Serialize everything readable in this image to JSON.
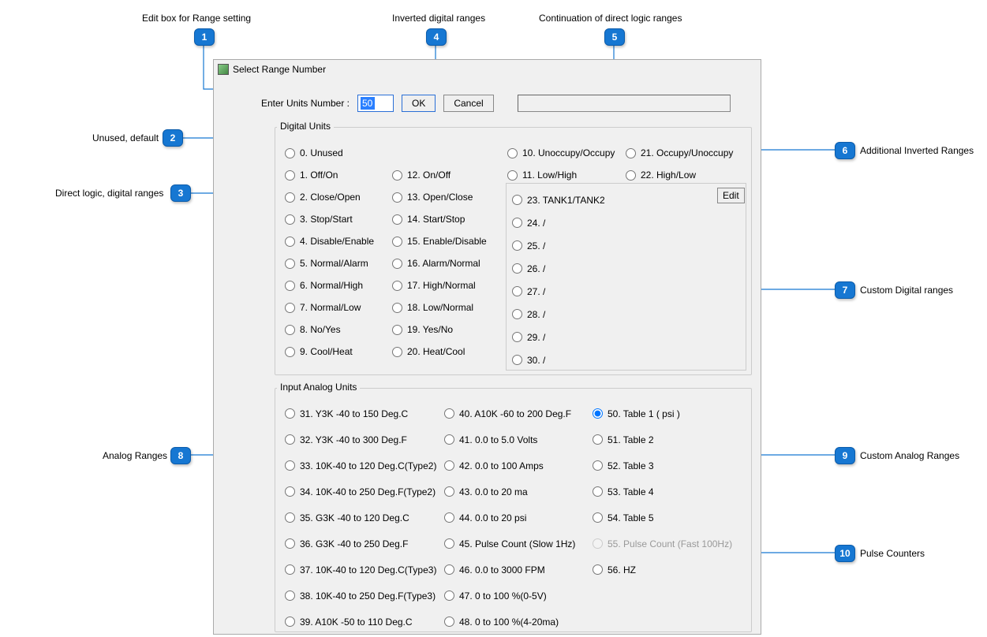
{
  "dialog": {
    "title": "Select Range Number",
    "enter_label": "Enter Units Number :",
    "enter_value": "50",
    "ok": "OK",
    "cancel": "Cancel"
  },
  "groups": {
    "digital": "Digital Units",
    "analog": "Input Analog Units"
  },
  "digital_col1": [
    "0. Unused",
    "1. Off/On",
    "2. Close/Open",
    "3. Stop/Start",
    "4. Disable/Enable",
    "5. Normal/Alarm",
    "6. Normal/High",
    "7. Normal/Low",
    "8. No/Yes",
    "9. Cool/Heat"
  ],
  "digital_col2": [
    "",
    "12. On/Off",
    "13. Open/Close",
    "14. Start/Stop",
    "15. Enable/Disable",
    "16. Alarm/Normal",
    "17. High/Normal",
    "18. Low/Normal",
    "19. Yes/No",
    "20. Heat/Cool"
  ],
  "digital_col3_top": [
    "10. Unoccupy/Occupy",
    "11. Low/High"
  ],
  "digital_col4_top": [
    "21. Occupy/Unoccupy",
    "22. High/Low"
  ],
  "custom_digital": [
    "23.   TANK1/TANK2",
    "24.    /",
    "25.    /",
    "26.    /",
    "27.    /",
    "28.    /",
    "29.    /",
    "30.    /"
  ],
  "custom_edit": "Edit",
  "analog_col1": [
    "31.  Y3K -40 to 150 Deg.C",
    "32.  Y3K -40 to 300 Deg.F",
    "33. 10K-40 to 120 Deg.C(Type2)",
    "34. 10K-40 to 250 Deg.F(Type2)",
    "35.  G3K -40 to 120 Deg.C",
    "36.  G3K -40 to 250 Deg.F",
    "37. 10K-40 to 120 Deg.C(Type3)",
    "38. 10K-40 to 250 Deg.F(Type3)",
    "39.  A10K -50 to 110 Deg.C"
  ],
  "analog_col2": [
    "40.  A10K -60 to 200 Deg.F",
    "41.  0.0 to 5.0 Volts",
    "42.  0.0 to 100  Amps",
    "43.  0.0 to 20  ma",
    "44.  0.0 to  20  psi",
    "45.  Pulse Count (Slow 1Hz)",
    "46.  0.0 to 3000 FPM",
    "47.  0 to 100  %(0-5V)",
    "48.  0 to 100  %(4-20ma)"
  ],
  "analog_col3": [
    "50.  Table 1 ( psi )",
    "51.  Table 2",
    "52.  Table 3",
    "53.  Table 4",
    "54.  Table 5",
    "55.  Pulse Count (Fast 100Hz)",
    "56.  HZ"
  ],
  "selected_analog_index": 0,
  "disabled_analog_col3_index": 5,
  "callouts": {
    "1": "Edit box for Range setting",
    "2": "Unused, default",
    "3": "Direct logic, digital ranges",
    "4": "Inverted digital ranges",
    "5": "Continuation of direct logic ranges",
    "6": "Additional Inverted Ranges",
    "7": "Custom Digital ranges",
    "8": "Analog Ranges",
    "9": "Custom Analog Ranges",
    "10": "Pulse Counters"
  }
}
